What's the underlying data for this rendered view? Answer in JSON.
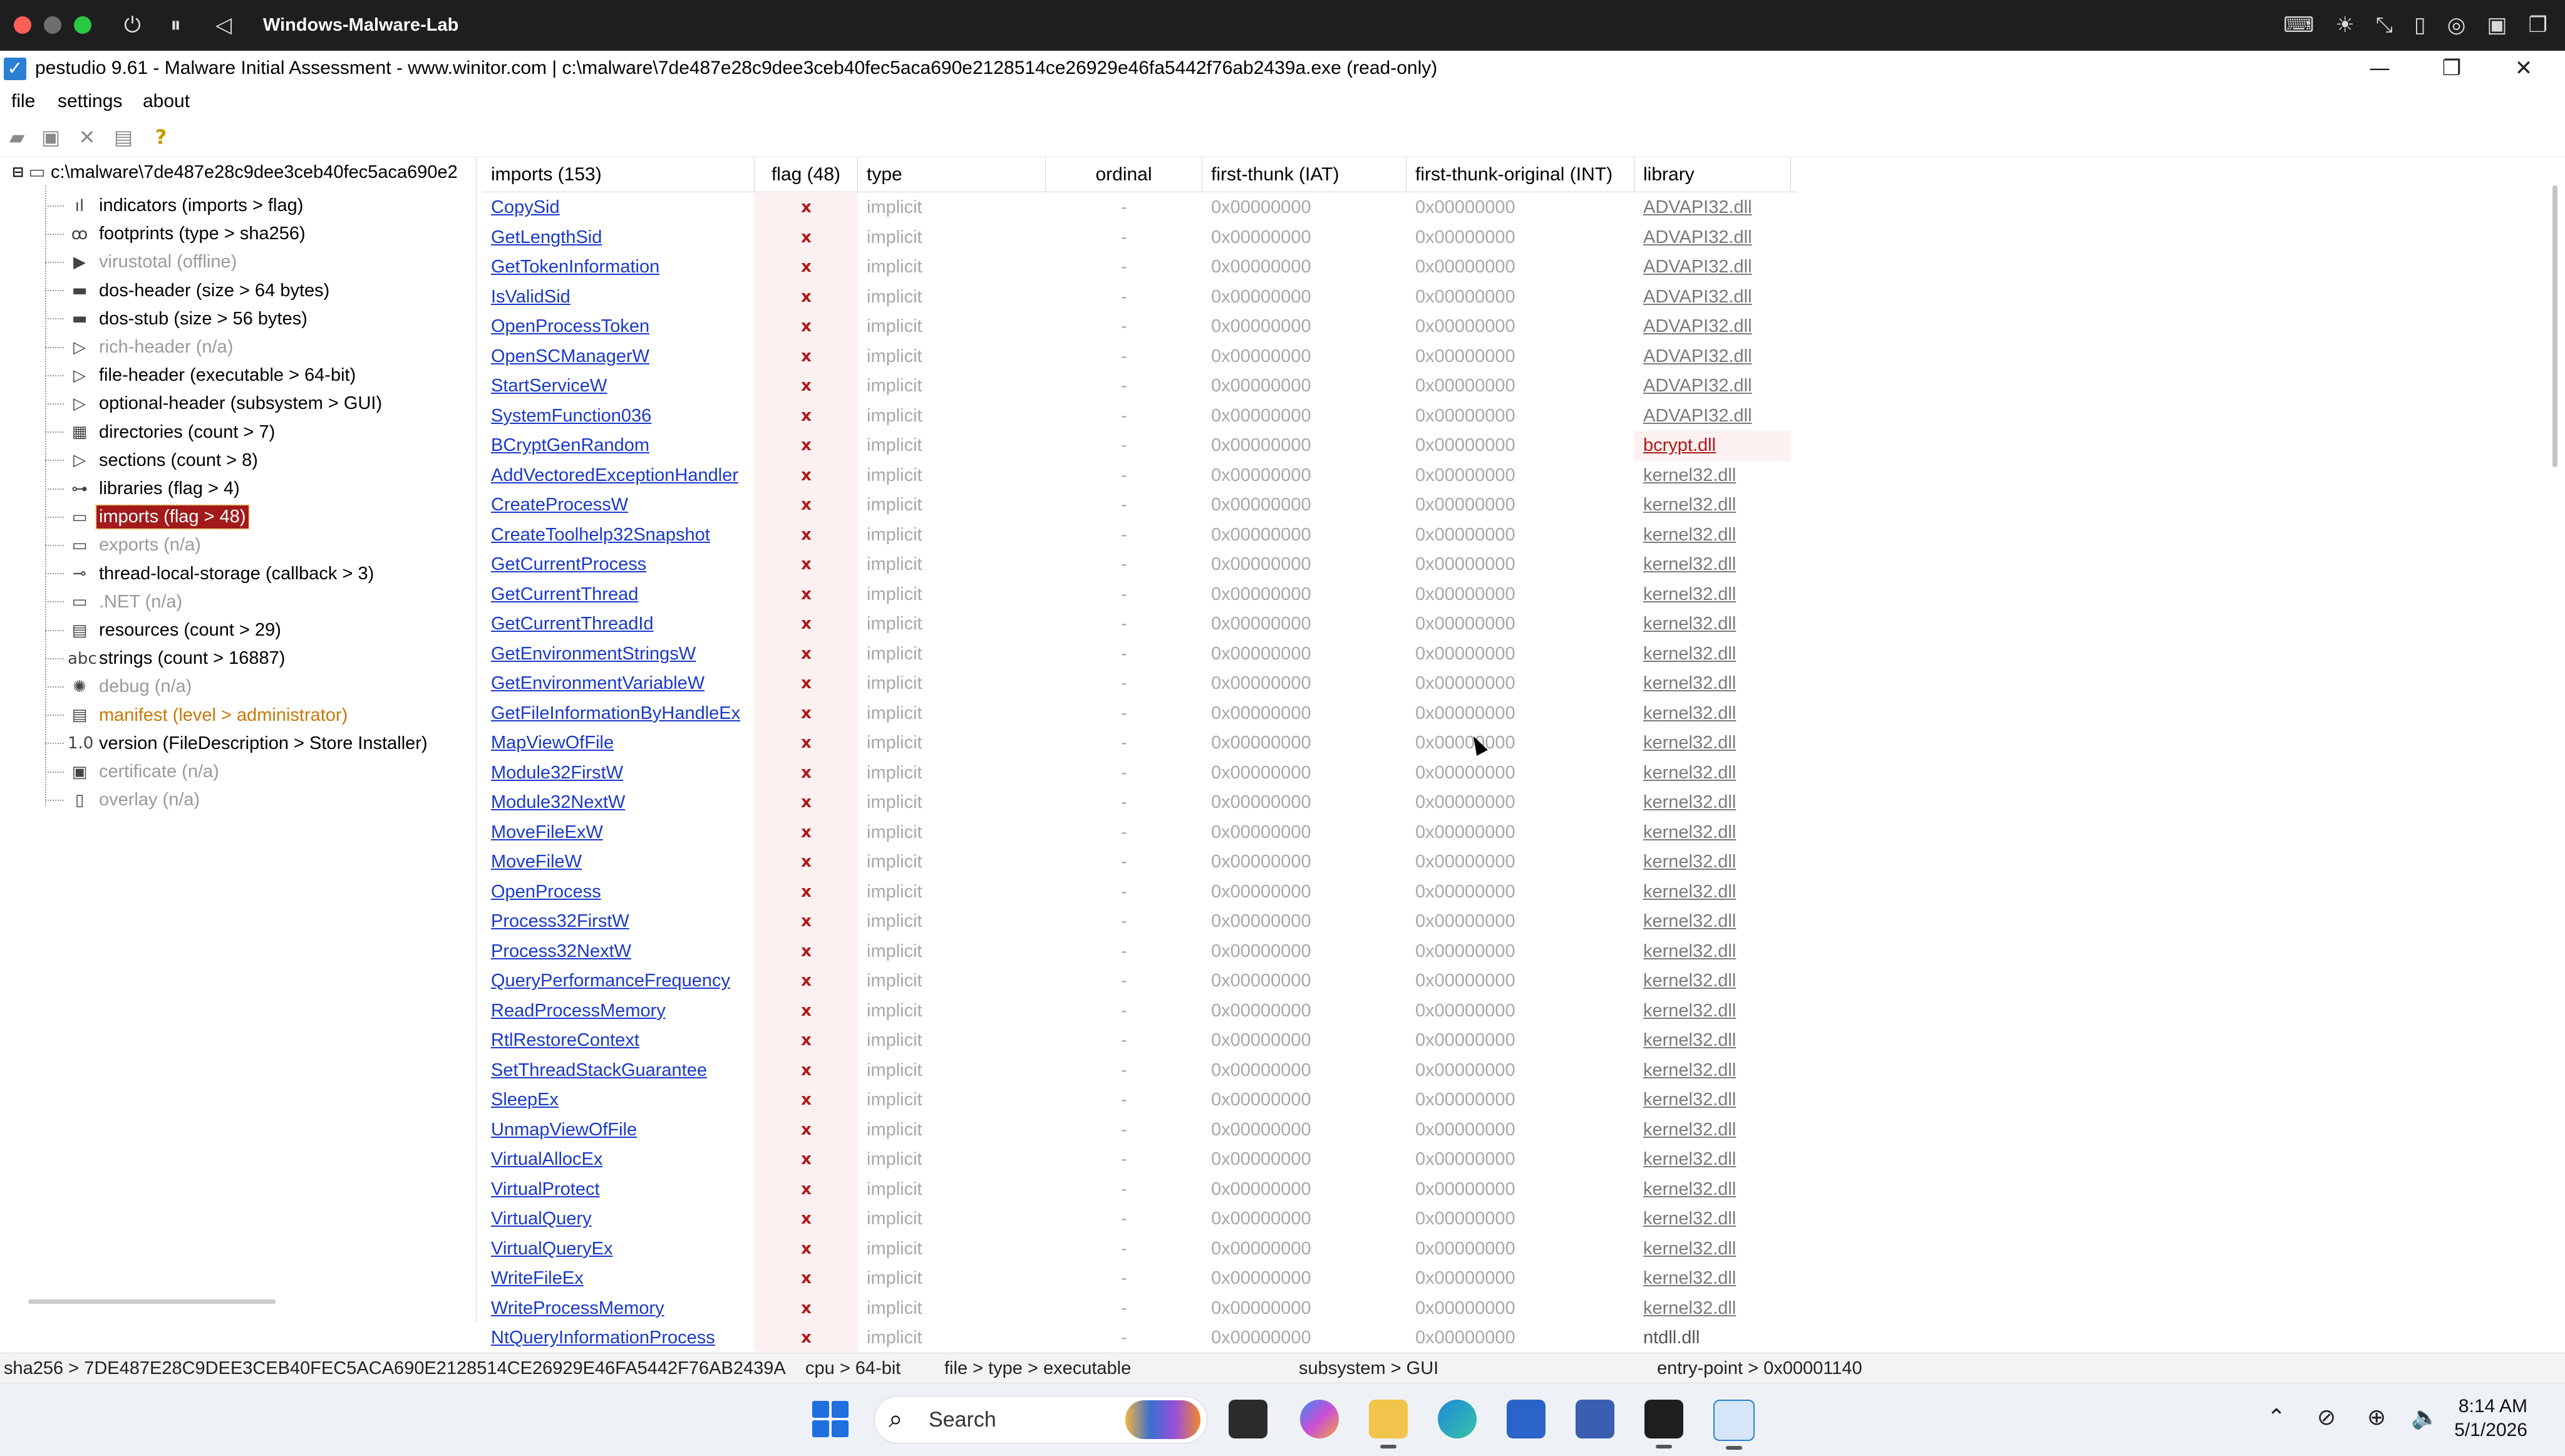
{
  "vm": {
    "title": "Windows-Malware-Lab",
    "controls": [
      "⏻",
      "⏸",
      "◁"
    ],
    "right_icons": [
      "⌨",
      "☀",
      "⤡",
      "▯",
      "◎",
      "▣",
      "❐"
    ]
  },
  "window": {
    "title": "pestudio 9.61 - Malware Initial Assessment - www.winitor.com | c:\\malware\\7de487e28c9dee3ceb40fec5aca690e2128514ce26929e46fa5442f76ab2439a.exe (read-only)",
    "controls": [
      "—",
      "❐",
      "✕"
    ]
  },
  "menu": [
    "file",
    "settings",
    "about"
  ],
  "toolbar_icons": [
    "open-icon",
    "save-icon",
    "close-file-icon",
    "clipboard-icon",
    "help-icon"
  ],
  "tree": {
    "root": "c:\\malware\\7de487e28c9dee3ceb40fec5aca690e2",
    "items": [
      {
        "label": "indicators (imports > flag)",
        "icon": "ıl",
        "state": "normal"
      },
      {
        "label": "footprints (type > sha256)",
        "icon": "ꝏ",
        "state": "normal"
      },
      {
        "label": "virustotal (offline)",
        "icon": "▶",
        "state": "grey"
      },
      {
        "label": "dos-header (size > 64 bytes)",
        "icon": "▬",
        "state": "normal"
      },
      {
        "label": "dos-stub (size > 56 bytes)",
        "icon": "▬",
        "state": "normal"
      },
      {
        "label": "rich-header (n/a)",
        "icon": "▷",
        "state": "grey"
      },
      {
        "label": "file-header (executable > 64-bit)",
        "icon": "▷",
        "state": "normal"
      },
      {
        "label": "optional-header (subsystem > GUI)",
        "icon": "▷",
        "state": "normal"
      },
      {
        "label": "directories (count > 7)",
        "icon": "▦",
        "state": "normal"
      },
      {
        "label": "sections (count > 8)",
        "icon": "▷",
        "state": "normal"
      },
      {
        "label": "libraries (flag > 4)",
        "icon": "⊶",
        "state": "normal"
      },
      {
        "label": "imports (flag > 48)",
        "icon": "▭",
        "state": "selected"
      },
      {
        "label": "exports (n/a)",
        "icon": "▭",
        "state": "grey"
      },
      {
        "label": "thread-local-storage (callback > 3)",
        "icon": "⊸",
        "state": "normal"
      },
      {
        "label": ".NET (n/a)",
        "icon": "▭",
        "state": "grey"
      },
      {
        "label": "resources (count > 29)",
        "icon": "▤",
        "state": "normal"
      },
      {
        "label": "strings (count > 16887)",
        "icon": "abc",
        "state": "normal"
      },
      {
        "label": "debug (n/a)",
        "icon": "✺",
        "state": "grey"
      },
      {
        "label": "manifest (level > administrator)",
        "icon": "▤",
        "state": "orange"
      },
      {
        "label": "version (FileDescription > Store Installer)",
        "icon": "1.0",
        "state": "normal"
      },
      {
        "label": "certificate (n/a)",
        "icon": "▣",
        "state": "grey"
      },
      {
        "label": "overlay (n/a)",
        "icon": "▯",
        "state": "grey"
      }
    ]
  },
  "table": {
    "headers": [
      "imports (153)",
      "flag (48)",
      "type",
      "ordinal",
      "first-thunk (IAT)",
      "first-thunk-original (INT)",
      "library"
    ],
    "flag_symbol": "x",
    "type_value": "implicit",
    "ordinal_value": "-",
    "thunk_value": "0x00000000",
    "rows": [
      {
        "name": "CopySid",
        "library": "ADVAPI32.dll"
      },
      {
        "name": "GetLengthSid",
        "library": "ADVAPI32.dll"
      },
      {
        "name": "GetTokenInformation",
        "library": "ADVAPI32.dll"
      },
      {
        "name": "IsValidSid",
        "library": "ADVAPI32.dll"
      },
      {
        "name": "OpenProcessToken",
        "library": "ADVAPI32.dll"
      },
      {
        "name": "OpenSCManagerW",
        "library": "ADVAPI32.dll"
      },
      {
        "name": "StartServiceW",
        "library": "ADVAPI32.dll"
      },
      {
        "name": "SystemFunction036",
        "library": "ADVAPI32.dll"
      },
      {
        "name": "BCryptGenRandom",
        "library": "bcrypt.dll",
        "lib_flagged": true
      },
      {
        "name": "AddVectoredExceptionHandler",
        "library": "kernel32.dll"
      },
      {
        "name": "CreateProcessW",
        "library": "kernel32.dll"
      },
      {
        "name": "CreateToolhelp32Snapshot",
        "library": "kernel32.dll"
      },
      {
        "name": "GetCurrentProcess",
        "library": "kernel32.dll"
      },
      {
        "name": "GetCurrentThread",
        "library": "kernel32.dll"
      },
      {
        "name": "GetCurrentThreadId",
        "library": "kernel32.dll"
      },
      {
        "name": "GetEnvironmentStringsW",
        "library": "kernel32.dll"
      },
      {
        "name": "GetEnvironmentVariableW",
        "library": "kernel32.dll"
      },
      {
        "name": "GetFileInformationByHandleEx",
        "library": "kernel32.dll"
      },
      {
        "name": "MapViewOfFile",
        "library": "kernel32.dll"
      },
      {
        "name": "Module32FirstW",
        "library": "kernel32.dll"
      },
      {
        "name": "Module32NextW",
        "library": "kernel32.dll"
      },
      {
        "name": "MoveFileExW",
        "library": "kernel32.dll"
      },
      {
        "name": "MoveFileW",
        "library": "kernel32.dll"
      },
      {
        "name": "OpenProcess",
        "library": "kernel32.dll"
      },
      {
        "name": "Process32FirstW",
        "library": "kernel32.dll"
      },
      {
        "name": "Process32NextW",
        "library": "kernel32.dll"
      },
      {
        "name": "QueryPerformanceFrequency",
        "library": "kernel32.dll"
      },
      {
        "name": "ReadProcessMemory",
        "library": "kernel32.dll"
      },
      {
        "name": "RtlRestoreContext",
        "library": "kernel32.dll"
      },
      {
        "name": "SetThreadStackGuarantee",
        "library": "kernel32.dll"
      },
      {
        "name": "SleepEx",
        "library": "kernel32.dll"
      },
      {
        "name": "UnmapViewOfFile",
        "library": "kernel32.dll"
      },
      {
        "name": "VirtualAllocEx",
        "library": "kernel32.dll"
      },
      {
        "name": "VirtualProtect",
        "library": "kernel32.dll"
      },
      {
        "name": "VirtualQuery",
        "library": "kernel32.dll"
      },
      {
        "name": "VirtualQueryEx",
        "library": "kernel32.dll"
      },
      {
        "name": "WriteFileEx",
        "library": "kernel32.dll"
      },
      {
        "name": "WriteProcessMemory",
        "library": "kernel32.dll"
      },
      {
        "name": "NtQueryInformationProcess",
        "library": "ntdll.dll",
        "lib_plain": true
      }
    ]
  },
  "status": {
    "sha256": "sha256 > 7DE487E28C9DEE3CEB40FEC5ACA690E2128514CE26929E46FA5442F76AB2439A",
    "cpu": "cpu > 64-bit",
    "file": "file > type > executable",
    "subsystem": "subsystem > GUI",
    "entry": "entry-point > 0x00001140"
  },
  "taskbar": {
    "search_label": "Search",
    "time": "8:14 AM",
    "date": "5/1/2026",
    "tray_icons": [
      "⌃",
      "⊘",
      "⊕",
      "🔈"
    ]
  },
  "colors": {
    "flag_red": "#b01818",
    "selection_red": "#a21a1a",
    "link_blue": "#1a3ac8",
    "manifest_orange": "#c8780a"
  }
}
